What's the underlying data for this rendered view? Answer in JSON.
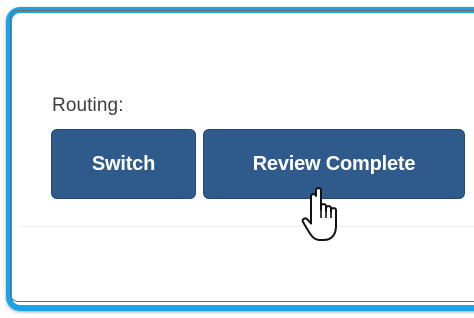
{
  "routing": {
    "label": "Routing:",
    "switch_label": "Switch",
    "review_complete_label": "Review Complete"
  },
  "colors": {
    "frame_border": "#19a3e8",
    "button_bg": "#2e5b8c",
    "button_text": "#ffffff",
    "label_text": "#3d3d3d"
  },
  "icons": {
    "cursor": "hand-pointer-cursor-icon"
  }
}
